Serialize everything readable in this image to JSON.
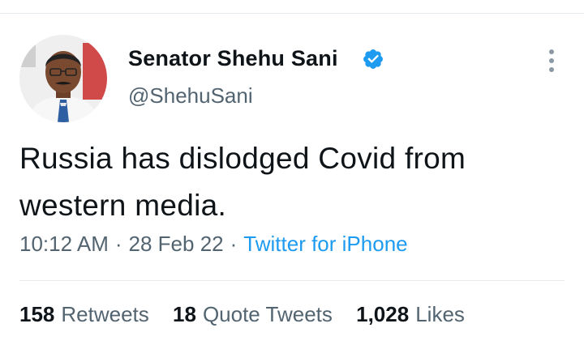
{
  "tweet": {
    "author_name": "Senator Shehu Sani",
    "handle": "@ShehuSani",
    "verified": true,
    "text_lines": [
      "Russia has dislodged Covid from",
      "western media."
    ],
    "time": "10:12 AM",
    "date": "28 Feb 22",
    "source": "Twitter for iPhone",
    "separator": "·"
  },
  "stats": {
    "retweets_count": "158",
    "retweets_label": "Retweets",
    "quote_tweets_count": "18",
    "quote_tweets_label": "Quote Tweets",
    "likes_count": "1,028",
    "likes_label": "Likes"
  },
  "icons": {
    "verified": "verified-badge-icon",
    "more": "more-options-icon"
  },
  "colors": {
    "accent": "#1d9bf0",
    "text_primary": "#0f1419",
    "text_secondary": "#536471",
    "divider": "#e6ecf0"
  }
}
